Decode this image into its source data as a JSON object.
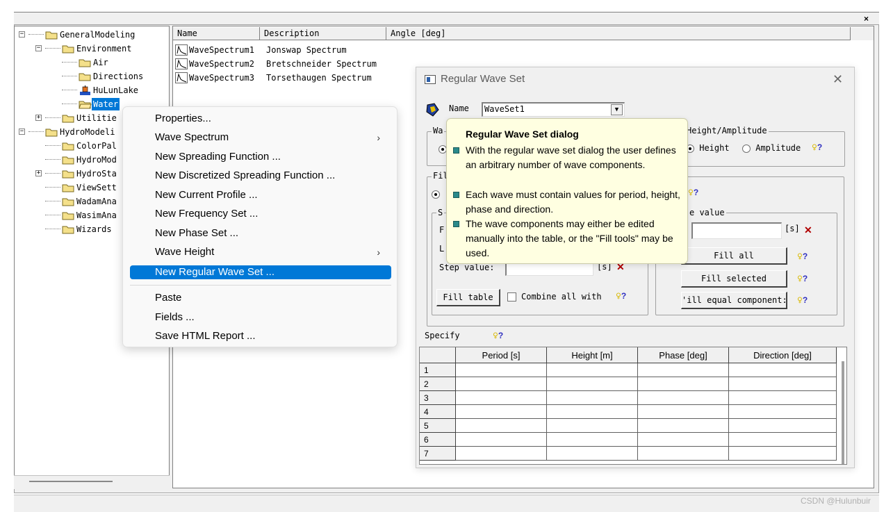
{
  "window": {
    "close_glyph": "×"
  },
  "tree": {
    "items": [
      {
        "label": "GeneralModeling",
        "level": 0,
        "expander": "−"
      },
      {
        "label": "Environment",
        "level": 1,
        "expander": "−"
      },
      {
        "label": "Air",
        "level": 2
      },
      {
        "label": "Directions",
        "level": 2
      },
      {
        "label": "HuLunLake",
        "level": 2
      },
      {
        "label": "Water",
        "level": 2,
        "selected": true
      },
      {
        "label": "Utilitie",
        "level": 1,
        "expander": "+"
      },
      {
        "label": "HydroModeli",
        "level": 0,
        "expander": "−"
      },
      {
        "label": "ColorPal",
        "level": 1
      },
      {
        "label": "HydroMod",
        "level": 1
      },
      {
        "label": "HydroSta",
        "level": 1,
        "expander": "+"
      },
      {
        "label": "ViewSett",
        "level": 1
      },
      {
        "label": "WadamAna",
        "level": 1
      },
      {
        "label": "WasimAna",
        "level": 1
      },
      {
        "label": "Wizards",
        "level": 1
      }
    ]
  },
  "list": {
    "columns": [
      "Name",
      "Description",
      "Angle [deg]"
    ],
    "rows": [
      {
        "name": "WaveSpectrum1",
        "description": "Jonswap Spectrum"
      },
      {
        "name": "WaveSpectrum2",
        "description": "Bretschneider Spectrum"
      },
      {
        "name": "WaveSpectrum3",
        "description": "Torsethaugen Spectrum"
      }
    ]
  },
  "context_menu": {
    "items": [
      {
        "label": "Properties..."
      },
      {
        "label": "Wave Spectrum",
        "submenu": true
      },
      {
        "label": "New Spreading Function ..."
      },
      {
        "label": "New Discretized Spreading Function ..."
      },
      {
        "label": "New Current Profile ..."
      },
      {
        "label": "New Frequency Set ..."
      },
      {
        "label": "New Phase Set ..."
      },
      {
        "label": "Wave Height",
        "submenu": true
      },
      {
        "label": "New Regular Wave Set ...",
        "highlighted": true
      },
      {
        "label": "Paste"
      },
      {
        "label": "Fields ..."
      },
      {
        "label": "Save HTML Report ..."
      }
    ],
    "submenu_glyph": "›"
  },
  "dialog": {
    "title": "Regular Wave Set",
    "close_glyph": "✕",
    "name_label": "Name",
    "name_value": "WaveSet1",
    "dropdown_glyph": "▼",
    "wave_group_label": "Wa",
    "fill_group_label": "Fil",
    "height_amplitude_label": "Height/Amplitude",
    "height_option": "Height",
    "amplitude_option": "Amplitude",
    "settings_group_label": "S",
    "from_label": "F",
    "last_label": "L",
    "step_label": "Step value:",
    "unit_s": "[s]",
    "value_group_label": "e value",
    "fill_table_button": "Fill table",
    "combine_label": "Combine all with",
    "fill_all_button": "Fill all",
    "fill_selected_button": "Fill selected",
    "fill_equal_button": "'ill equal component:",
    "specify_label": "Specify",
    "help_glyph": "?",
    "clear_glyph": "✕"
  },
  "grid": {
    "columns": [
      "Period [s]",
      "Height [m]",
      "Phase [deg]",
      "Direction [deg]"
    ],
    "rows": [
      "1",
      "2",
      "3",
      "4",
      "5",
      "6",
      "7"
    ]
  },
  "tooltip": {
    "title": "Regular Wave Set dialog",
    "bullets": [
      "With the regular wave set dialog the user defines an arbitrary number of wave components.",
      "Each wave must contain values for period, height, phase and direction.",
      "The wave components may either be edited manually into the table, or the \"Fill tools\" may be used."
    ]
  },
  "watermark": "CSDN @Hulunbuir"
}
